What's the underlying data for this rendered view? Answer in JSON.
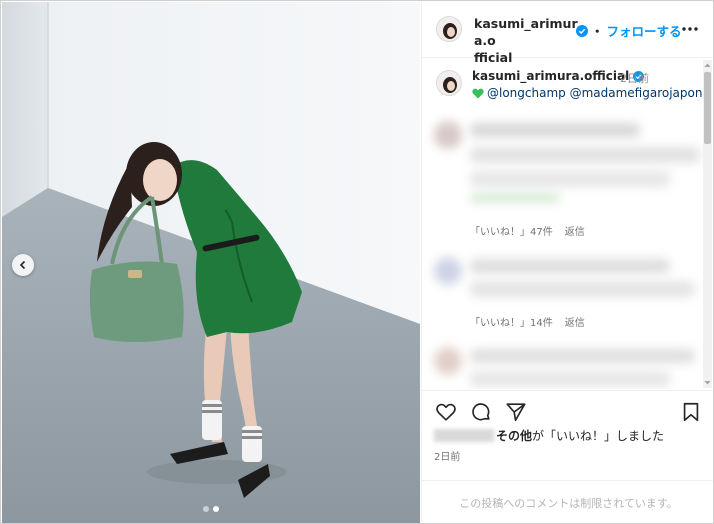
{
  "post": {
    "username": "kasumi_arimura.official",
    "username_wrapped_a": "kasumi_arimura.o",
    "username_wrapped_b": "fficial",
    "follow_separator": "・",
    "follow_label": "フォローする",
    "more_icon": "more-horizontal-icon"
  },
  "caption": {
    "username": "kasumi_arimura.official",
    "time": "2日前",
    "emoji": "green-heart-icon",
    "text": "@longchamp @madamefigarojapon"
  },
  "comments": [
    {
      "likes": "「いいね！」47件",
      "reply": "返信"
    },
    {
      "likes": "「いいね！」14件",
      "reply": "返信"
    }
  ],
  "actions": {
    "like_icon": "heart-icon",
    "comment_icon": "comment-icon",
    "share_icon": "send-icon",
    "save_icon": "bookmark-icon"
  },
  "likes": {
    "strong": "その他",
    "text": "が「いいね！」しました"
  },
  "post_time": "2日前",
  "restricted_notice": "この投稿へのコメントは制限されています。",
  "carousel": {
    "count": 2,
    "active": 2
  },
  "colors": {
    "accent": "#0095f6",
    "verified": "#0095f6",
    "green_heart": "#3bbf5c",
    "outfit_green": "#1f7a3c"
  }
}
